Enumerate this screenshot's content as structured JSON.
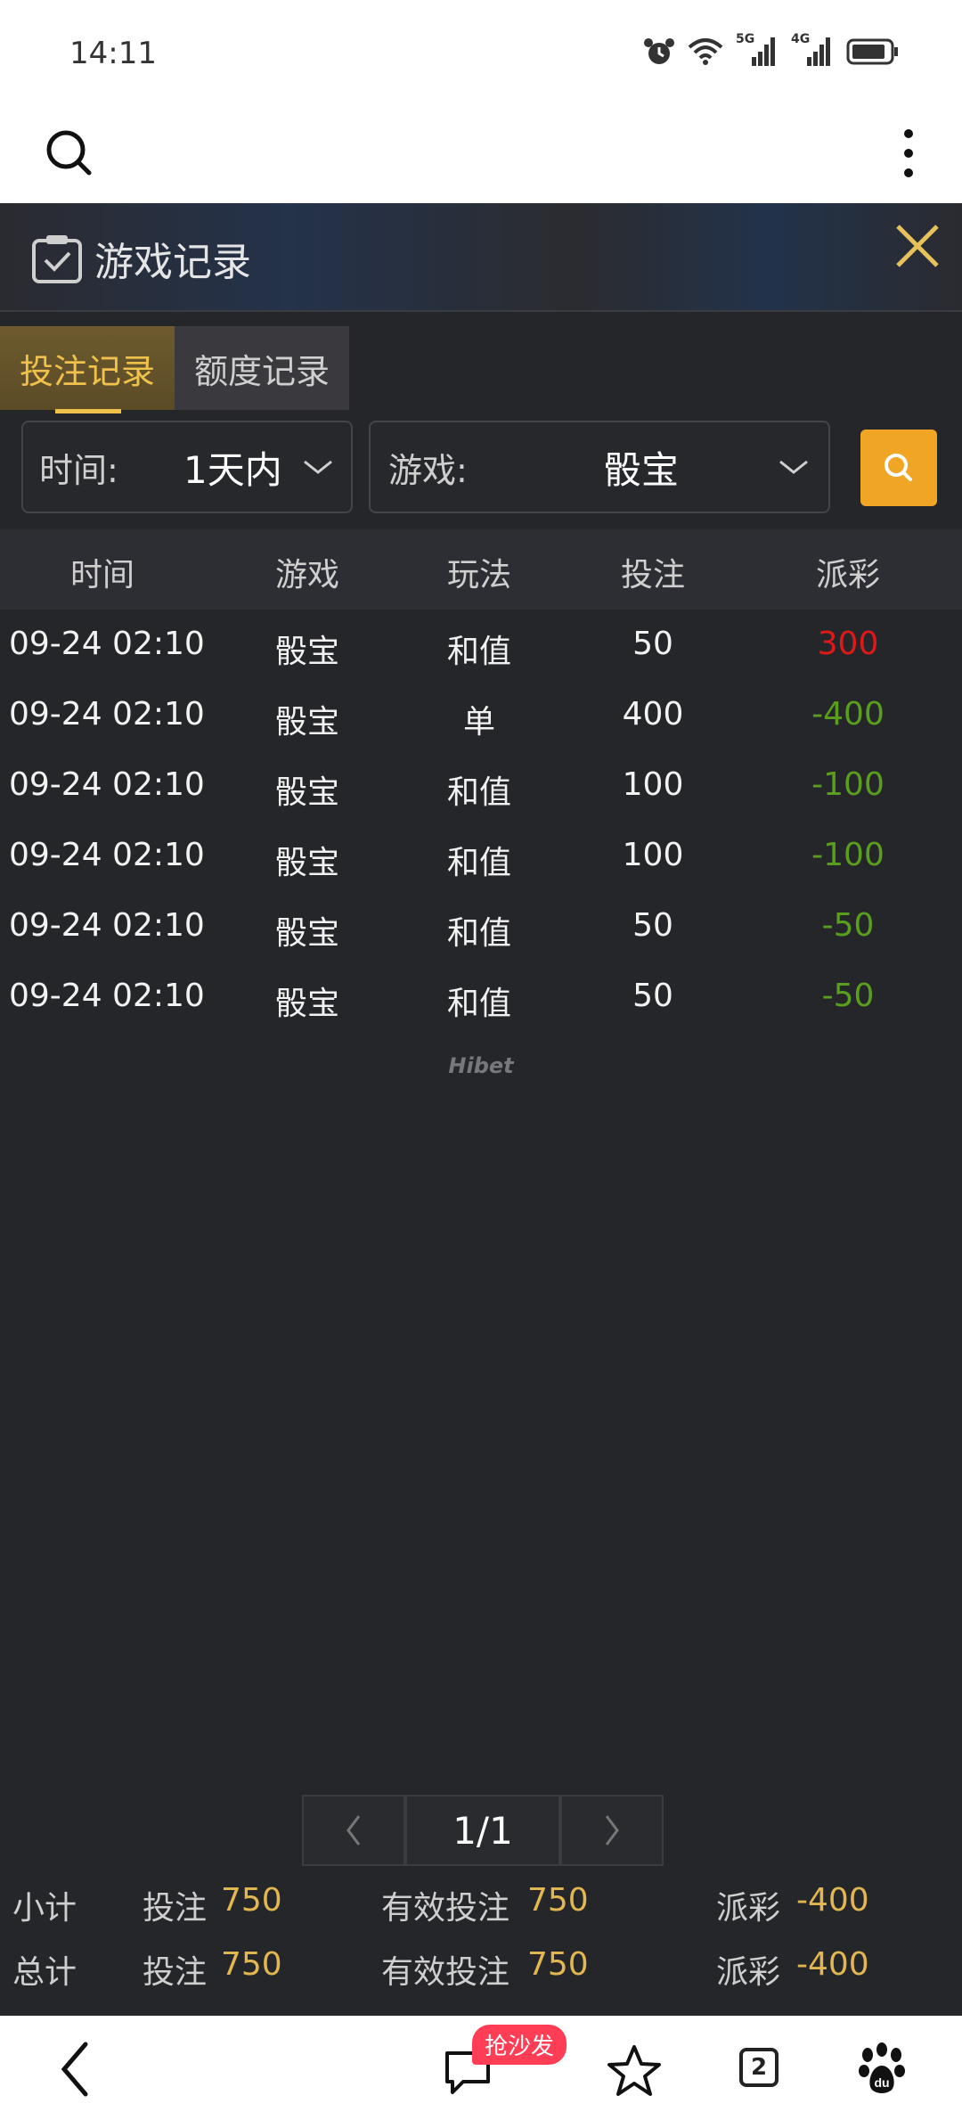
{
  "status_bar": {
    "time": "14:11",
    "net1": "5G",
    "net2": "4G"
  },
  "panel": {
    "title": "游戏记录"
  },
  "tabs": [
    {
      "label": "投注记录"
    },
    {
      "label": "额度记录"
    }
  ],
  "filters": {
    "time_label": "时间:",
    "time_value": "1天内",
    "game_label": "游戏:",
    "game_value": "骰宝"
  },
  "table": {
    "headers": [
      "时间",
      "游戏",
      "玩法",
      "投注",
      "派彩"
    ],
    "rows": [
      [
        "09-24 02:10",
        "骰宝",
        "和值",
        "50",
        "300"
      ],
      [
        "09-24 02:10",
        "骰宝",
        "单",
        "400",
        "-400"
      ],
      [
        "09-24 02:10",
        "骰宝",
        "和值",
        "100",
        "-100"
      ],
      [
        "09-24 02:10",
        "骰宝",
        "和值",
        "100",
        "-100"
      ],
      [
        "09-24 02:10",
        "骰宝",
        "和值",
        "50",
        "-50"
      ],
      [
        "09-24 02:10",
        "骰宝",
        "和值",
        "50",
        "-50"
      ]
    ]
  },
  "watermark": "Hibet",
  "pagination": {
    "current": "1/1"
  },
  "summary": [
    {
      "label": "小计",
      "bet_label": "投注",
      "bet": "750",
      "valid_label": "有效投注",
      "valid": "750",
      "payout_label": "派彩",
      "payout": "-400"
    },
    {
      "label": "总计",
      "bet_label": "投注",
      "bet": "750",
      "valid_label": "有效投注",
      "valid": "750",
      "payout_label": "派彩",
      "payout": "-400"
    }
  ],
  "nav": {
    "comment_badge": "抢沙发",
    "tab_count": "2"
  },
  "colors": {
    "accent": "#f0c14b",
    "search_button": "#f0a624",
    "win": "#e01818",
    "loss": "#5a9e1e",
    "panel_bg": "#252629"
  }
}
